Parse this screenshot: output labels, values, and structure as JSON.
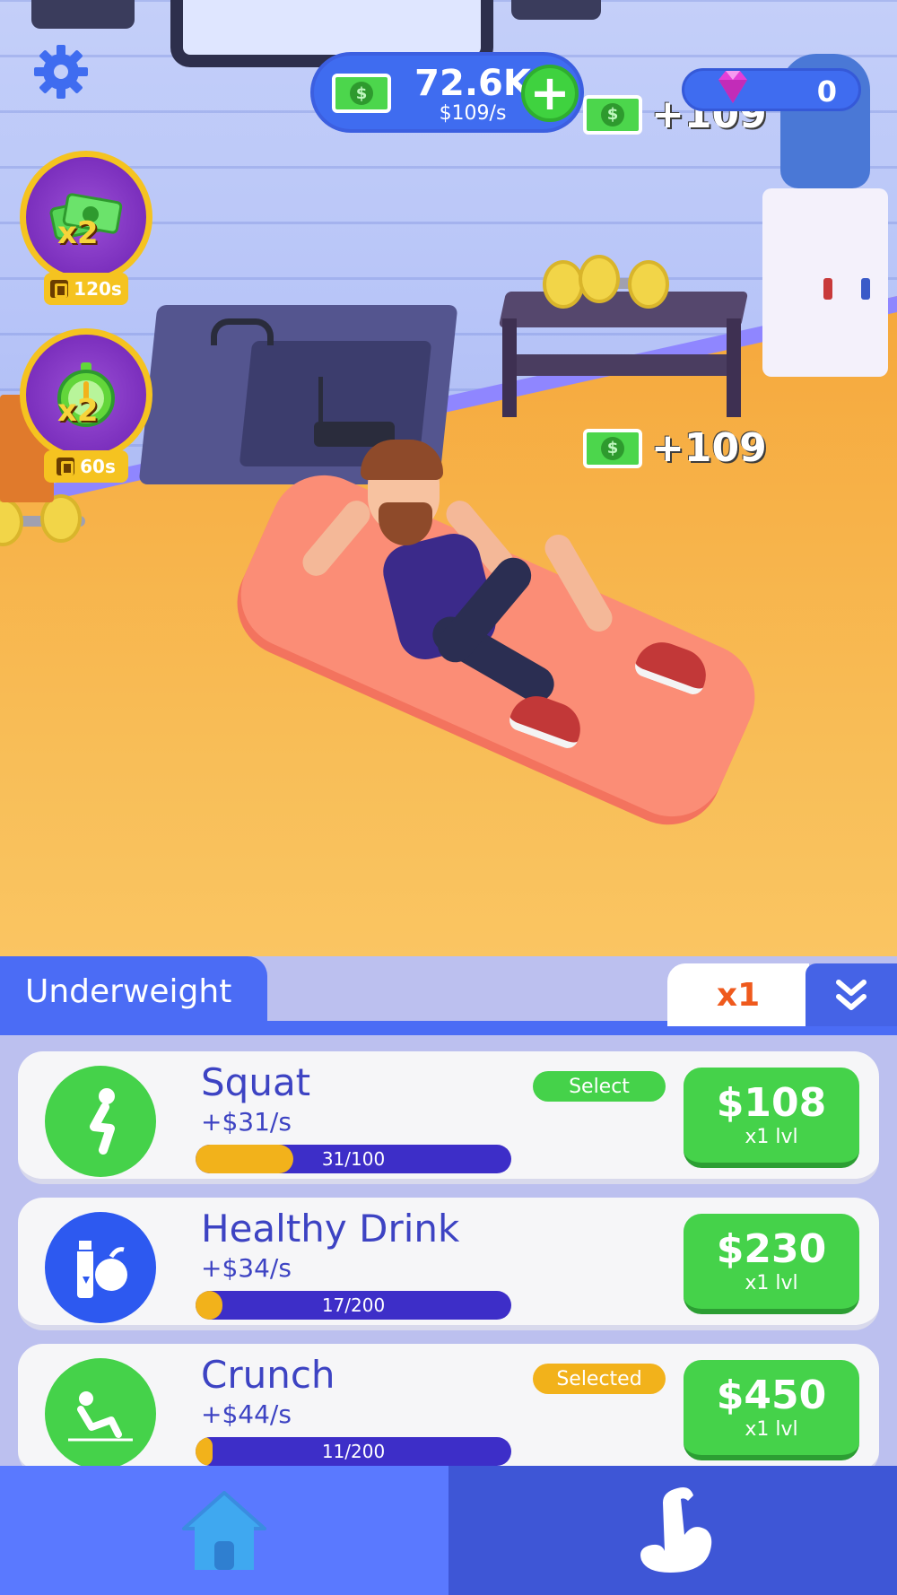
{
  "hud": {
    "money_amount": "72.6K",
    "money_rate": "$109/s",
    "gem_count": "0",
    "floating_rewards": [
      "+109",
      "+109"
    ]
  },
  "boosts": [
    {
      "multiplier": "x2",
      "timer": "120s",
      "icon": "cash-stack-icon"
    },
    {
      "multiplier": "x2",
      "timer": "60s",
      "icon": "stopwatch-icon"
    }
  ],
  "panel": {
    "tab_title": "Underweight",
    "multiplier": "x1"
  },
  "exercises": [
    {
      "name": "Squat",
      "rate": "+$31/s",
      "progress": "31/100",
      "progress_value": 0.31,
      "tag": "Select",
      "price": "$108",
      "level": "x1 lvl",
      "icon": "squat-icon",
      "icon_color": "#45d24a",
      "tag_color": "#45d24a"
    },
    {
      "name": "Healthy Drink",
      "rate": "+$34/s",
      "progress": "17/200",
      "progress_value": 0.085,
      "tag": "",
      "price": "$230",
      "level": "x1 lvl",
      "icon": "drink-apple-icon",
      "icon_color": "#2d59f0",
      "tag_color": ""
    },
    {
      "name": "Crunch",
      "rate": "+$44/s",
      "progress": "11/200",
      "progress_value": 0.055,
      "tag": "Selected",
      "price": "$450",
      "level": "x1 lvl",
      "icon": "crunch-icon",
      "icon_color": "#45d24a",
      "tag_color": "#f2b21b"
    }
  ],
  "nav": {
    "items": [
      {
        "icon": "home-icon"
      },
      {
        "icon": "muscle-arm-icon"
      }
    ]
  },
  "colors": {
    "accent_blue": "#4b6cf5",
    "buy_green": "#45d24a",
    "progress_yellow": "#f2b21b",
    "progress_purple": "#3d2ec8"
  }
}
